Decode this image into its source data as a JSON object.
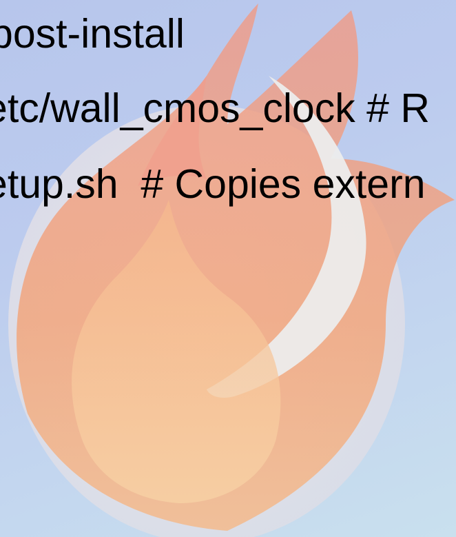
{
  "wallpaper": {
    "icon": "flame-logo-icon",
    "colors": {
      "background": "#bccbee",
      "egg": "#e6e6e6",
      "flame": "#f2a07a",
      "flame_light": "#f7c99a"
    }
  },
  "text_lines": [
    "post-install",
    "etc/wall_cmos_clock # R",
    "etup.sh  # Copies extern"
  ]
}
